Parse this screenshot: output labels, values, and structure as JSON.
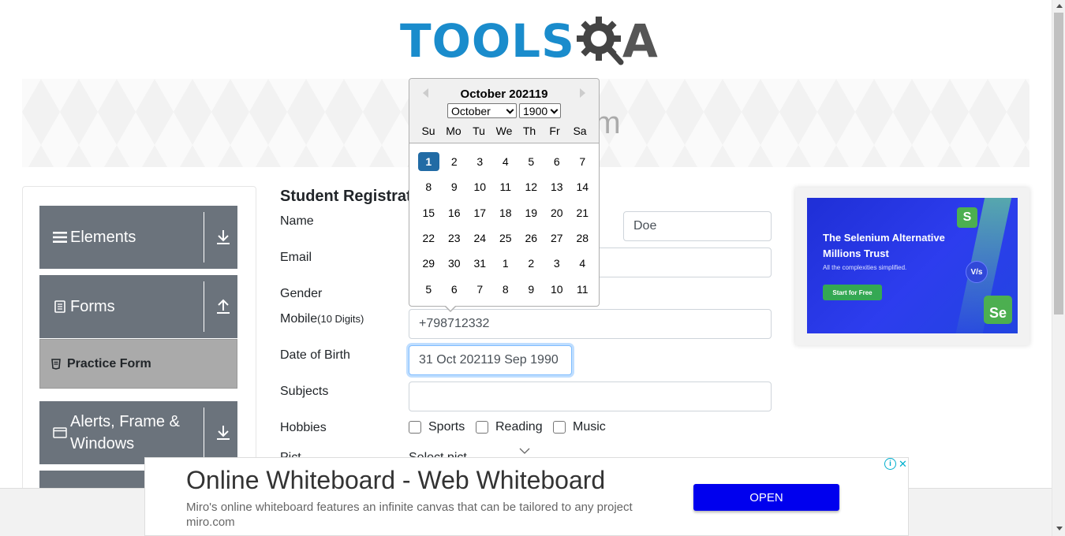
{
  "header": {
    "logo_text_left": "TOOLS",
    "logo_text_right": "A"
  },
  "banner": {
    "title": "rm"
  },
  "colors": {
    "accent": "#1a8ccc",
    "sidebar_header": "#6b737c",
    "selected_day": "#216ba5",
    "cta_blue": "#0000ee"
  },
  "sidebar": {
    "groups": [
      {
        "label": "Elements",
        "icon": "hamburger-icon",
        "arrow": "arrow-down-icon"
      },
      {
        "label": "Forms",
        "icon": "document-icon",
        "arrow": "arrow-up-icon"
      },
      {
        "label": "Alerts, Frame &",
        "label2": "Windows",
        "icon": "window-icon",
        "arrow": "arrow-down-icon"
      }
    ],
    "active_item": {
      "label": "Practice Form",
      "icon": "form-icon"
    }
  },
  "form": {
    "title": "Student Registrati",
    "name_label": "Name",
    "last_name_value": "Doe",
    "email_label": "Email",
    "gender_label": "Gender",
    "mobile_label": "Mobile",
    "mobile_hint": "(10 Digits)",
    "mobile_value": "+798712332",
    "dob_label": "Date of Birth",
    "dob_value": "31 Oct 202119 Sep 1990",
    "subjects_label": "Subjects",
    "subjects_value": "",
    "hobbies_label": "Hobbies",
    "hobbies": [
      "Sports",
      "Reading",
      "Music"
    ],
    "picture_label": "Pict",
    "picture_select": "Select pict"
  },
  "datepicker": {
    "month_title": "October 202119",
    "month_select": "October",
    "year_select": "1900",
    "weekdays": [
      "Su",
      "Mo",
      "Tu",
      "We",
      "Th",
      "Fr",
      "Sa"
    ],
    "weeks": [
      [
        "1",
        "2",
        "3",
        "4",
        "5",
        "6",
        "7"
      ],
      [
        "8",
        "9",
        "10",
        "11",
        "12",
        "13",
        "14"
      ],
      [
        "15",
        "16",
        "17",
        "18",
        "19",
        "20",
        "21"
      ],
      [
        "22",
        "23",
        "24",
        "25",
        "26",
        "27",
        "28"
      ],
      [
        "29",
        "30",
        "31",
        "1",
        "2",
        "3",
        "4"
      ],
      [
        "5",
        "6",
        "7",
        "8",
        "9",
        "10",
        "11"
      ]
    ],
    "selected_day": "1"
  },
  "right_ad": {
    "headline": "The Selenium Alternative Millions Trust",
    "subtext": "All the complexities simplified.",
    "cta": "Start for Free",
    "badge_s": "S",
    "badge_se": "Se",
    "vs": "V/s"
  },
  "bottom_ad": {
    "headline": "Online Whiteboard - Web Whiteboard",
    "description": "Miro's online whiteboard features an infinite canvas that can be tailored to any project",
    "domain": "miro.com",
    "cta": "OPEN",
    "info": "i",
    "close": "✕"
  }
}
